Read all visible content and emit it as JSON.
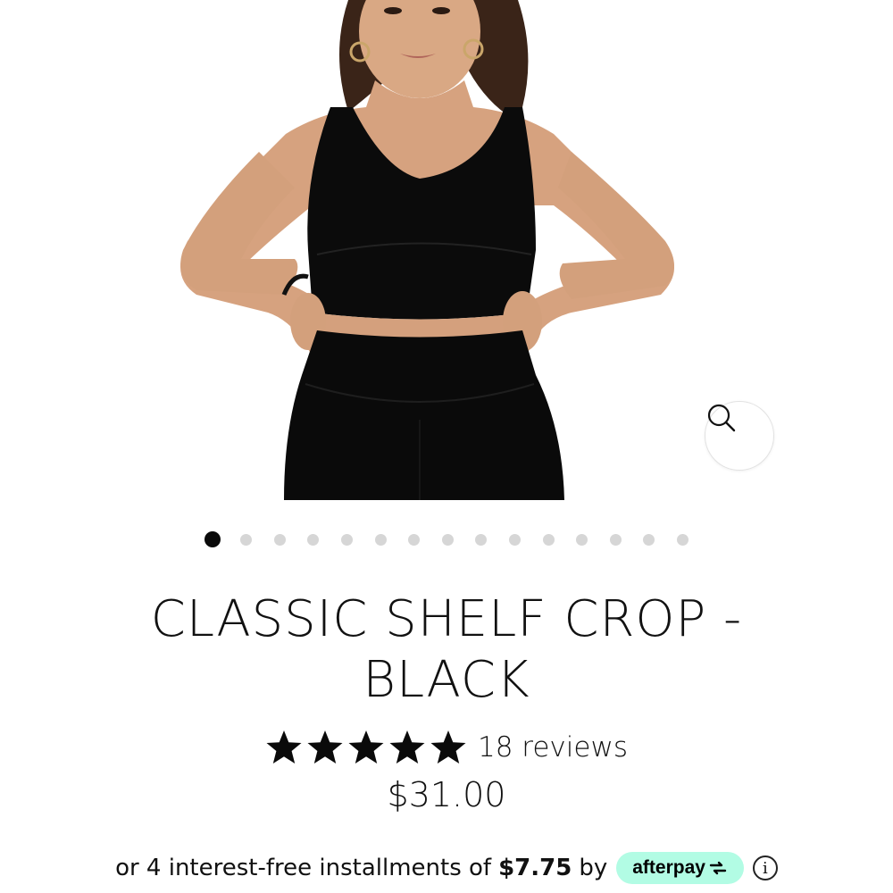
{
  "product": {
    "title_line1": "CLASSIC SHELF CROP -",
    "title_line2": "BLACK",
    "rating": 5,
    "reviews_label": "18 reviews",
    "price": "$31.00"
  },
  "gallery": {
    "image_count": 15,
    "active_index": 0
  },
  "afterpay": {
    "prefix": "or 4 interest-free installments of",
    "amount": "$7.75",
    "by": "by",
    "brand": "afterpay",
    "badge_color": "#b2fce4"
  },
  "icons": {
    "zoom": "magnifier-icon",
    "star": "star-icon",
    "info": "info-icon"
  }
}
